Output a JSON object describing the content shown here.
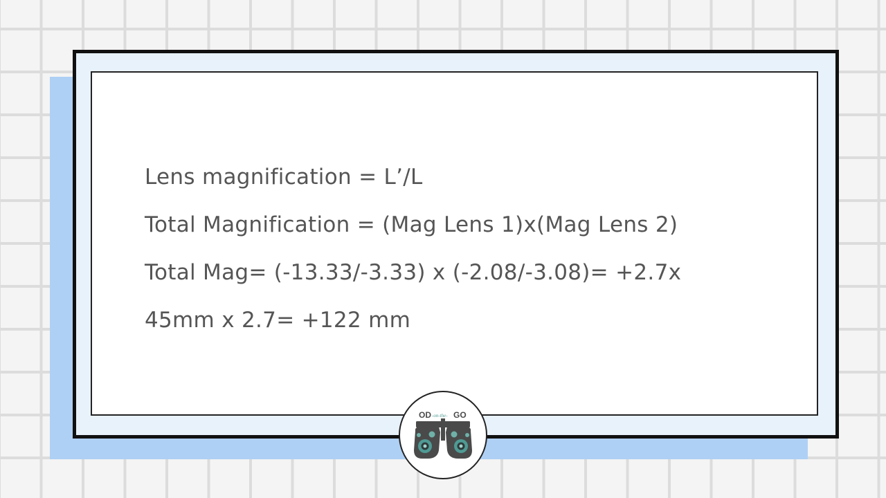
{
  "slide": {
    "lines": [
      "Lens magnification = L’/L",
      "Total Magnification = (Mag Lens 1)x(Mag Lens 2)",
      "Total Mag= (-13.33/-3.33) x (-2.08/-3.08)= +2.7x",
      "45mm x 2.7= +122 mm"
    ]
  },
  "logo": {
    "text_left": "OD",
    "text_mid": "-on-the-",
    "text_right": "GO",
    "icon": "phoropter-icon"
  },
  "colors": {
    "background": "#f4f4f4",
    "grid": "#dcdcdc",
    "shadow": "#aed0f4",
    "frame_fill": "#e8f2fb",
    "text": "#555555",
    "logo_teal": "#4f9a94"
  }
}
